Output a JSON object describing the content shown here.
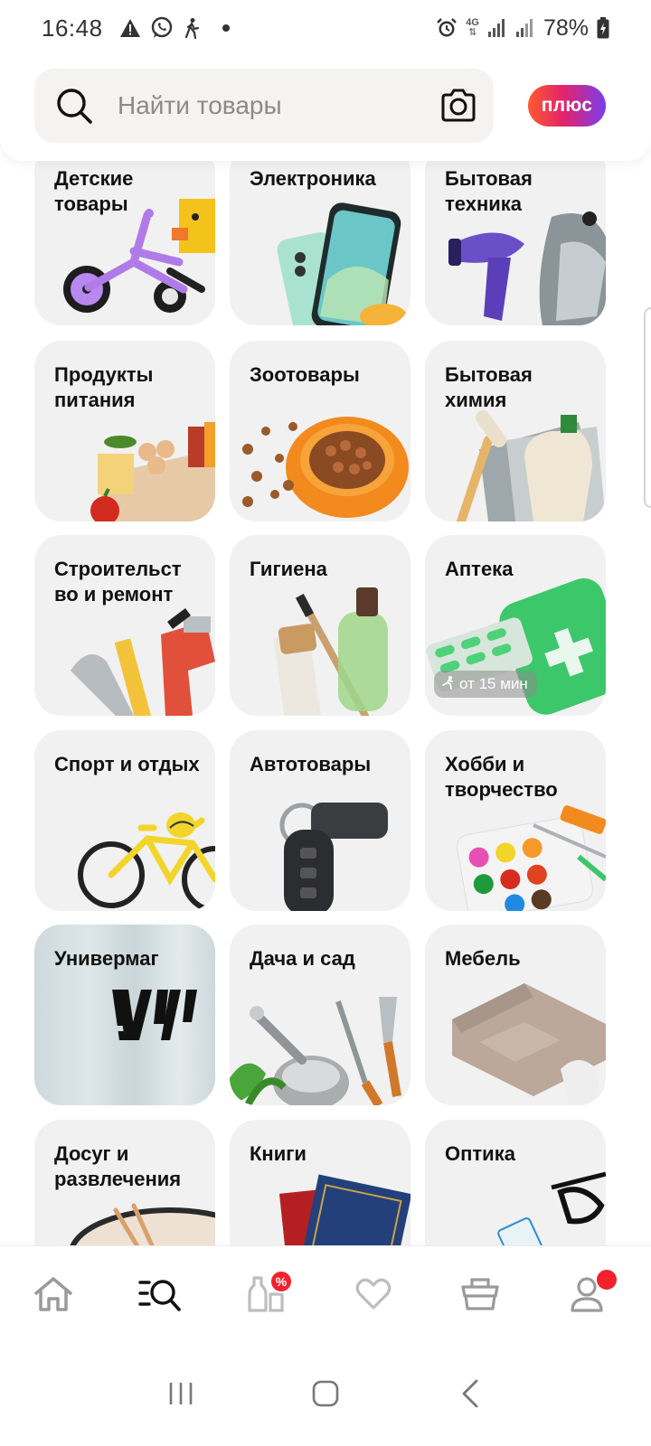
{
  "status_bar": {
    "time": "16:48",
    "network": "4G",
    "battery": "78%",
    "icons": [
      "warning-icon",
      "whatsapp-icon",
      "accessibility-icon",
      "alarm-icon",
      "signal-icon",
      "battery-icon"
    ]
  },
  "search": {
    "placeholder": "Найти товары"
  },
  "plus_badge": "плюс",
  "categories": [
    {
      "label": "Детские товары"
    },
    {
      "label": "Электроника"
    },
    {
      "label": "Бытовая техника"
    },
    {
      "label": "Продукты питания"
    },
    {
      "label": "Зоотовары"
    },
    {
      "label": "Бытовая химия"
    },
    {
      "label": "Строительст во и ремонт"
    },
    {
      "label": "Гигиена"
    },
    {
      "label": "Аптека",
      "badge": "от 15 мин"
    },
    {
      "label": "Спорт и отдых"
    },
    {
      "label": "Автотовары"
    },
    {
      "label": "Хобби и творчество"
    },
    {
      "label": "Универмаг"
    },
    {
      "label": "Дача и сад"
    },
    {
      "label": "Мебель"
    },
    {
      "label": "Досуг и развлечения"
    },
    {
      "label": "Книги"
    },
    {
      "label": "Оптика"
    }
  ],
  "bottom_nav": {
    "items": [
      "home",
      "catalog",
      "discounts",
      "favorites",
      "cart",
      "profile"
    ],
    "discount_badge": "%"
  },
  "colors": {
    "accent_red": "#f3212d",
    "plus_gradient_start": "#ff5a2e",
    "plus_gradient_end": "#7a3cf0",
    "tile_bg": "#f1f1f1"
  }
}
